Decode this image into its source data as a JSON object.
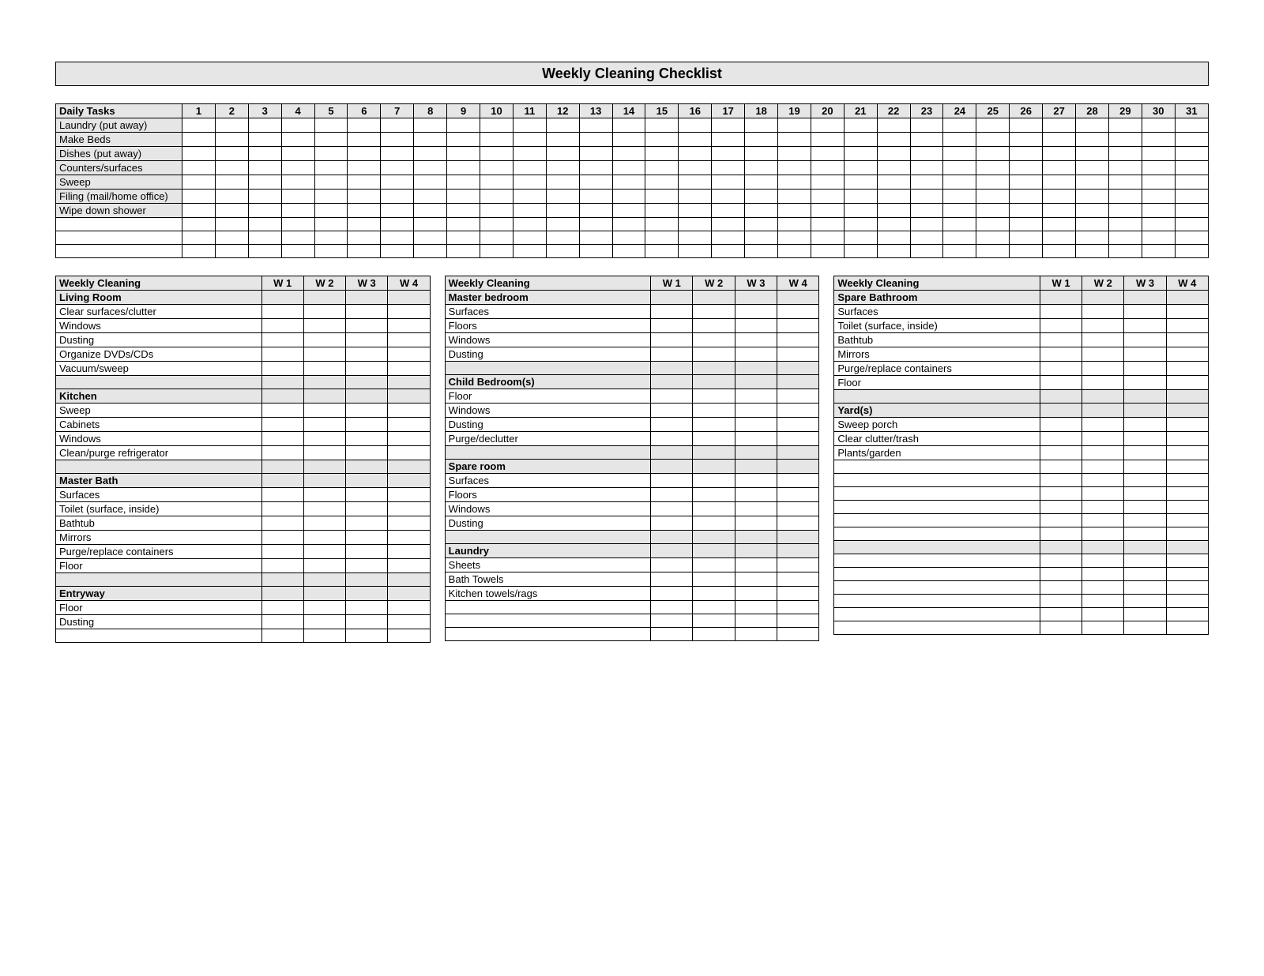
{
  "title": "Weekly Cleaning Checklist",
  "daily": {
    "header_label": "Daily Tasks",
    "days": 31,
    "tasks": [
      "Laundry (put away)",
      "Make Beds",
      "Dishes (put away)",
      "Counters/surfaces",
      "Sweep",
      "Filing (mail/home office)",
      "Wipe down shower"
    ],
    "blank_rows": 3
  },
  "weekly": {
    "header_label": "Weekly Cleaning",
    "week_labels": [
      "W 1",
      "W 2",
      "W 3",
      "W 4"
    ],
    "columns": [
      {
        "rows": [
          {
            "type": "section",
            "text": "Living Room"
          },
          {
            "type": "task",
            "text": "Clear surfaces/clutter"
          },
          {
            "type": "task",
            "text": "Windows"
          },
          {
            "type": "task",
            "text": "Dusting"
          },
          {
            "type": "task",
            "text": "Organize DVDs/CDs"
          },
          {
            "type": "task",
            "text": "Vacuum/sweep"
          },
          {
            "type": "spacer"
          },
          {
            "type": "section",
            "text": "Kitchen"
          },
          {
            "type": "task",
            "text": "Sweep"
          },
          {
            "type": "task",
            "text": "Cabinets"
          },
          {
            "type": "task",
            "text": "Windows"
          },
          {
            "type": "task",
            "text": "Clean/purge refrigerator"
          },
          {
            "type": "spacer"
          },
          {
            "type": "section",
            "text": "Master Bath"
          },
          {
            "type": "task",
            "text": "Surfaces"
          },
          {
            "type": "task",
            "text": "Toilet (surface, inside)"
          },
          {
            "type": "task",
            "text": "Bathtub"
          },
          {
            "type": "task",
            "text": "Mirrors"
          },
          {
            "type": "task",
            "text": "Purge/replace containers"
          },
          {
            "type": "task",
            "text": "Floor"
          },
          {
            "type": "spacer"
          },
          {
            "type": "section",
            "text": "Entryway"
          },
          {
            "type": "task",
            "text": "Floor"
          },
          {
            "type": "task",
            "text": "Dusting"
          },
          {
            "type": "blank"
          }
        ]
      },
      {
        "rows": [
          {
            "type": "section",
            "text": "Master bedroom"
          },
          {
            "type": "task",
            "text": "Surfaces"
          },
          {
            "type": "task",
            "text": "Floors"
          },
          {
            "type": "task",
            "text": "Windows"
          },
          {
            "type": "task",
            "text": "Dusting"
          },
          {
            "type": "spacer"
          },
          {
            "type": "section",
            "text": "Child Bedroom(s)"
          },
          {
            "type": "task",
            "text": "Floor"
          },
          {
            "type": "task",
            "text": "Windows"
          },
          {
            "type": "task",
            "text": "Dusting"
          },
          {
            "type": "task",
            "text": "Purge/declutter"
          },
          {
            "type": "spacer"
          },
          {
            "type": "section",
            "text": "Spare room"
          },
          {
            "type": "task",
            "text": "Surfaces"
          },
          {
            "type": "task",
            "text": "Floors"
          },
          {
            "type": "task",
            "text": "Windows"
          },
          {
            "type": "task",
            "text": "Dusting"
          },
          {
            "type": "spacer"
          },
          {
            "type": "section",
            "text": "Laundry"
          },
          {
            "type": "task",
            "text": "Sheets"
          },
          {
            "type": "task",
            "text": "Bath Towels"
          },
          {
            "type": "task",
            "text": "Kitchen towels/rags"
          },
          {
            "type": "blank"
          },
          {
            "type": "blank"
          },
          {
            "type": "blank"
          }
        ]
      },
      {
        "rows": [
          {
            "type": "section",
            "text": "Spare Bathroom"
          },
          {
            "type": "task",
            "text": "Surfaces"
          },
          {
            "type": "task",
            "text": "Toilet (surface, inside)"
          },
          {
            "type": "task",
            "text": "Bathtub"
          },
          {
            "type": "task",
            "text": "Mirrors"
          },
          {
            "type": "task",
            "text": "Purge/replace containers"
          },
          {
            "type": "task",
            "text": "Floor"
          },
          {
            "type": "spacer"
          },
          {
            "type": "section",
            "text": "Yard(s)"
          },
          {
            "type": "task",
            "text": "Sweep porch"
          },
          {
            "type": "task",
            "text": "Clear clutter/trash"
          },
          {
            "type": "task",
            "text": "Plants/garden"
          },
          {
            "type": "blank"
          },
          {
            "type": "blank"
          },
          {
            "type": "blank"
          },
          {
            "type": "blank"
          },
          {
            "type": "blank"
          },
          {
            "type": "blank"
          },
          {
            "type": "spacer"
          },
          {
            "type": "blank"
          },
          {
            "type": "blank"
          },
          {
            "type": "blank"
          },
          {
            "type": "blank"
          },
          {
            "type": "blank"
          },
          {
            "type": "blank"
          }
        ]
      }
    ]
  }
}
